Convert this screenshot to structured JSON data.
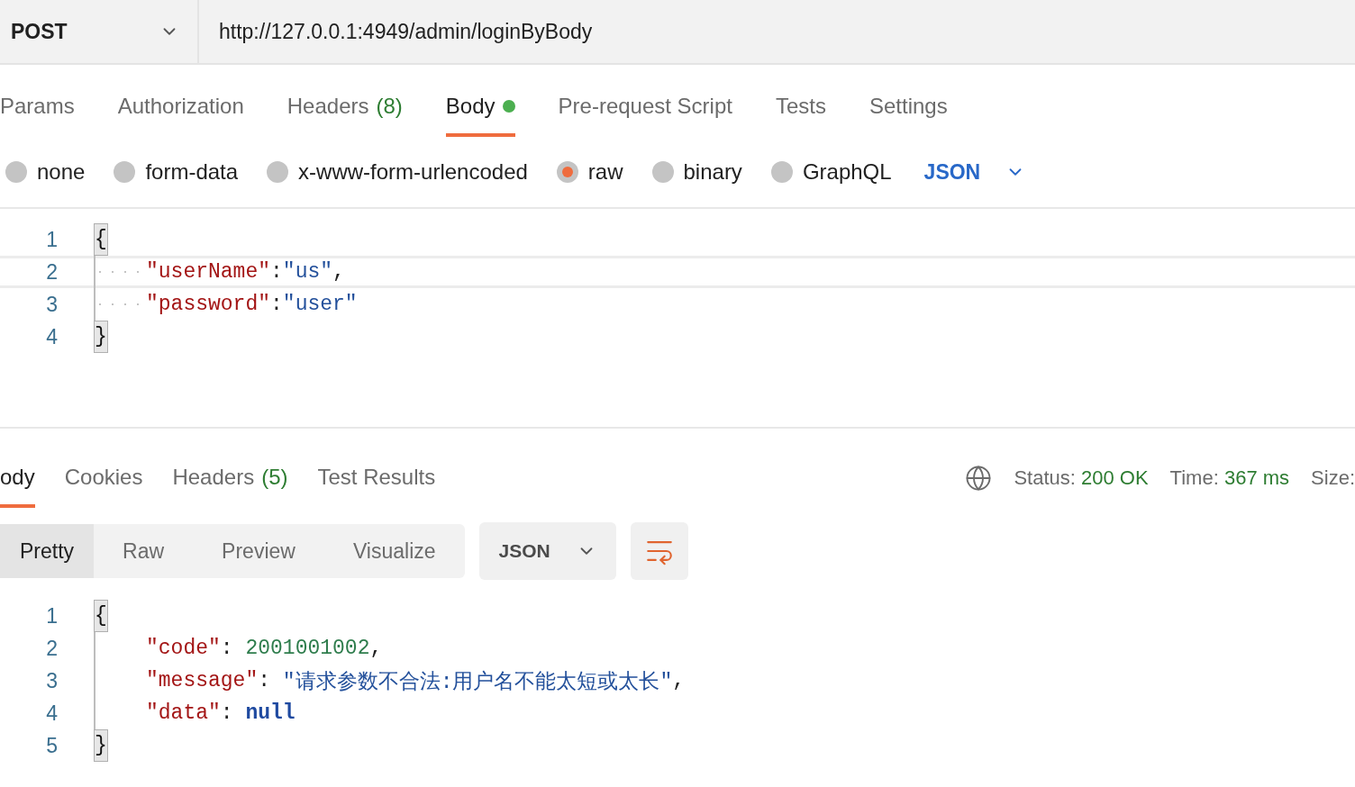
{
  "request": {
    "method": "POST",
    "url": "http://127.0.0.1:4949/admin/loginByBody"
  },
  "request_tabs": [
    {
      "label": "Params",
      "selected": false
    },
    {
      "label": "Authorization",
      "selected": false
    },
    {
      "label": "Headers",
      "count": "(8)",
      "selected": false
    },
    {
      "label": "Body",
      "selected": true,
      "dot": true
    },
    {
      "label": "Pre-request Script",
      "selected": false
    },
    {
      "label": "Tests",
      "selected": false
    },
    {
      "label": "Settings",
      "selected": false
    }
  ],
  "body_types": [
    {
      "label": "none",
      "selected": false
    },
    {
      "label": "form-data",
      "selected": false
    },
    {
      "label": "x-www-form-urlencoded",
      "selected": false
    },
    {
      "label": "raw",
      "selected": true
    },
    {
      "label": "binary",
      "selected": false
    },
    {
      "label": "GraphQL",
      "selected": false
    }
  ],
  "body_format": "JSON",
  "request_editor": {
    "show_whitespace": true,
    "lines": [
      {
        "number": "1",
        "active": false,
        "indented": false,
        "tokens": [
          {
            "kind": "bracket",
            "text": "{"
          }
        ]
      },
      {
        "number": "2",
        "active": true,
        "indented": true,
        "tokens": [
          {
            "kind": "key",
            "text": "\"userName\""
          },
          {
            "kind": "punct",
            "text": ":"
          },
          {
            "kind": "string",
            "text": "\"us\""
          },
          {
            "kind": "punct",
            "text": ","
          }
        ]
      },
      {
        "number": "3",
        "active": false,
        "indented": true,
        "tokens": [
          {
            "kind": "key",
            "text": "\"password\""
          },
          {
            "kind": "punct",
            "text": ":"
          },
          {
            "kind": "string",
            "text": "\"user\""
          }
        ]
      },
      {
        "number": "4",
        "active": false,
        "indented": false,
        "tokens": [
          {
            "kind": "bracket",
            "text": "}"
          }
        ]
      }
    ]
  },
  "response_tabs": [
    {
      "label": "ody",
      "selected": true
    },
    {
      "label": "Cookies",
      "selected": false
    },
    {
      "label": "Headers",
      "count": "(5)",
      "selected": false
    },
    {
      "label": "Test Results",
      "selected": false
    }
  ],
  "response_meta": [
    {
      "label": "Status:",
      "value": "200 OK"
    },
    {
      "label": "Time:",
      "value": "367 ms"
    },
    {
      "label": "Size:"
    }
  ],
  "view_modes": [
    {
      "label": "Pretty",
      "selected": true
    },
    {
      "label": "Raw",
      "selected": false
    },
    {
      "label": "Preview",
      "selected": false
    },
    {
      "label": "Visualize",
      "selected": false
    }
  ],
  "response_format": "JSON",
  "response_editor": {
    "show_whitespace": false,
    "lines": [
      {
        "number": "1",
        "active": false,
        "indented": false,
        "tokens": [
          {
            "kind": "bracket",
            "text": "{"
          }
        ]
      },
      {
        "number": "2",
        "active": false,
        "indented": true,
        "tokens": [
          {
            "kind": "key",
            "text": "\"code\""
          },
          {
            "kind": "punct",
            "text": ": "
          },
          {
            "kind": "number",
            "text": "2001001002"
          },
          {
            "kind": "punct",
            "text": ","
          }
        ]
      },
      {
        "number": "3",
        "active": false,
        "indented": true,
        "tokens": [
          {
            "kind": "key",
            "text": "\"message\""
          },
          {
            "kind": "punct",
            "text": ": "
          },
          {
            "kind": "string",
            "text": "\"请求参数不合法:用户名不能太短或太长\""
          },
          {
            "kind": "punct",
            "text": ","
          }
        ]
      },
      {
        "number": "4",
        "active": false,
        "indented": true,
        "tokens": [
          {
            "kind": "key",
            "text": "\"data\""
          },
          {
            "kind": "punct",
            "text": ": "
          },
          {
            "kind": "keyword",
            "text": "null"
          }
        ]
      },
      {
        "number": "5",
        "active": false,
        "indented": false,
        "tokens": [
          {
            "kind": "bracket",
            "text": "}"
          }
        ]
      }
    ]
  }
}
